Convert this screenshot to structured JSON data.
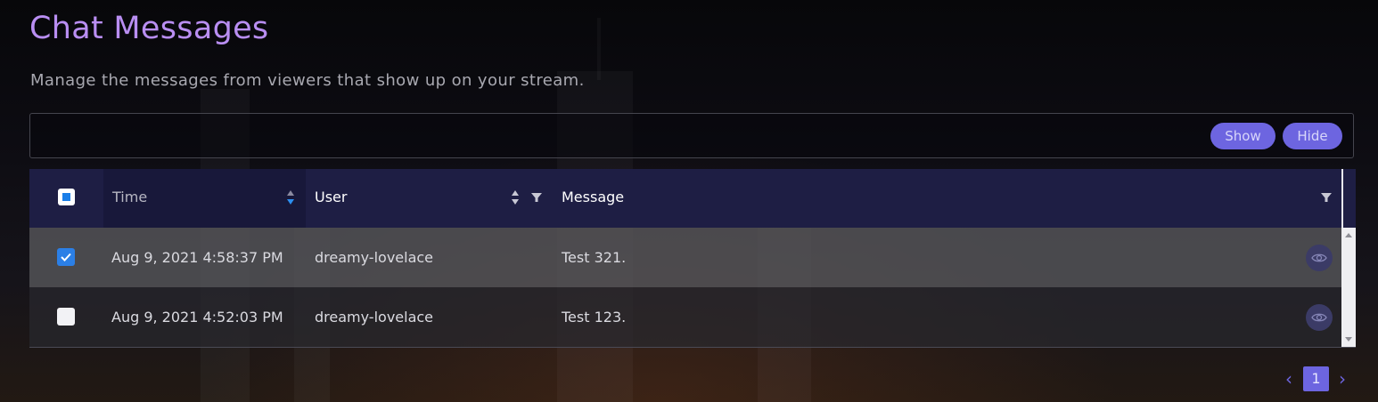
{
  "page": {
    "title": "Chat Messages",
    "subtitle": "Manage the messages from viewers that show up on your stream."
  },
  "toolbar": {
    "show_label": "Show",
    "hide_label": "Hide"
  },
  "table": {
    "columns": {
      "time": "Time",
      "user": "User",
      "message": "Message"
    },
    "select_all_state": "indeterminate",
    "rows": [
      {
        "selected": true,
        "time": "Aug 9, 2021 4:58:37 PM",
        "user": "dreamy-lovelace",
        "message": "Test 321.",
        "action_icon": "eye-icon"
      },
      {
        "selected": false,
        "time": "Aug 9, 2021 4:52:03 PM",
        "user": "dreamy-lovelace",
        "message": "Test 123.",
        "action_icon": "eye-icon"
      }
    ]
  },
  "pagination": {
    "prev_icon": "chevron-left-icon",
    "current_page": "1",
    "next_icon": "chevron-right-icon"
  },
  "colors": {
    "title": "#b98ef2",
    "accent": "#6d65e0",
    "header_bg": "#1e1e44",
    "checkbox_blue": "#2b7fe6"
  }
}
